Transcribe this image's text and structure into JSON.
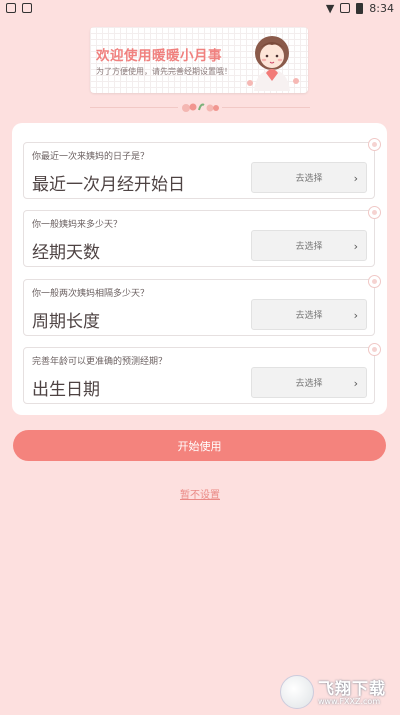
{
  "status_bar": {
    "time": "8:34"
  },
  "banner": {
    "title": "欢迎使用暖暖小月事",
    "subtitle": "为了方便使用，请先完善经期设置哦！"
  },
  "fields": [
    {
      "hint": "你最近一次来姨妈的日子是？",
      "label": "最近一次月经开始日",
      "button": "去选择"
    },
    {
      "hint": "你一般姨妈来多少天？",
      "label": "经期天数",
      "button": "去选择"
    },
    {
      "hint": "你一般两次姨妈相隔多少天？",
      "label": "周期长度",
      "button": "去选择"
    },
    {
      "hint": "完善年龄可以更准确的预测经期？",
      "label": "出生日期",
      "button": "去选择"
    }
  ],
  "actions": {
    "start": "开始使用",
    "skip": "暂不设置"
  },
  "watermark": {
    "text": "飞翔下载",
    "url": "www.FXXZ.com"
  },
  "colors": {
    "accent": "#f4837d",
    "background": "#fde0df",
    "title": "#f0817f"
  }
}
